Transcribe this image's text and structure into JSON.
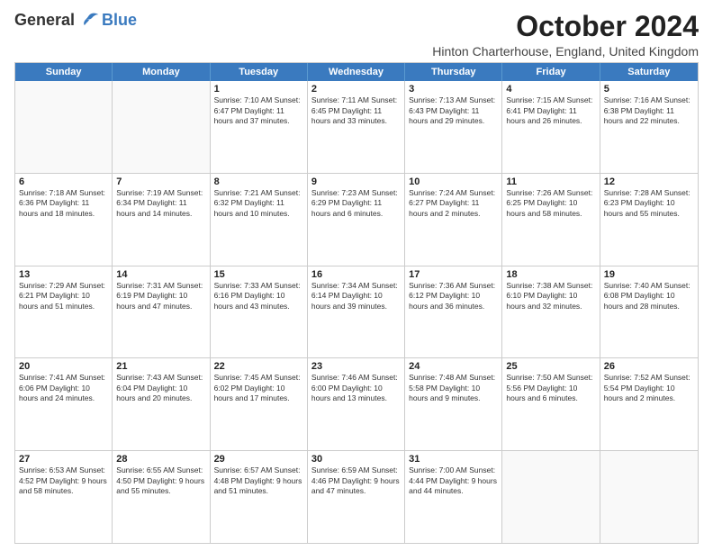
{
  "logo": {
    "general": "General",
    "blue": "Blue"
  },
  "title": "October 2024",
  "location": "Hinton Charterhouse, England, United Kingdom",
  "header_days": [
    "Sunday",
    "Monday",
    "Tuesday",
    "Wednesday",
    "Thursday",
    "Friday",
    "Saturday"
  ],
  "rows": [
    [
      {
        "day": "",
        "text": ""
      },
      {
        "day": "",
        "text": ""
      },
      {
        "day": "1",
        "text": "Sunrise: 7:10 AM\nSunset: 6:47 PM\nDaylight: 11 hours and 37 minutes."
      },
      {
        "day": "2",
        "text": "Sunrise: 7:11 AM\nSunset: 6:45 PM\nDaylight: 11 hours and 33 minutes."
      },
      {
        "day": "3",
        "text": "Sunrise: 7:13 AM\nSunset: 6:43 PM\nDaylight: 11 hours and 29 minutes."
      },
      {
        "day": "4",
        "text": "Sunrise: 7:15 AM\nSunset: 6:41 PM\nDaylight: 11 hours and 26 minutes."
      },
      {
        "day": "5",
        "text": "Sunrise: 7:16 AM\nSunset: 6:38 PM\nDaylight: 11 hours and 22 minutes."
      }
    ],
    [
      {
        "day": "6",
        "text": "Sunrise: 7:18 AM\nSunset: 6:36 PM\nDaylight: 11 hours and 18 minutes."
      },
      {
        "day": "7",
        "text": "Sunrise: 7:19 AM\nSunset: 6:34 PM\nDaylight: 11 hours and 14 minutes."
      },
      {
        "day": "8",
        "text": "Sunrise: 7:21 AM\nSunset: 6:32 PM\nDaylight: 11 hours and 10 minutes."
      },
      {
        "day": "9",
        "text": "Sunrise: 7:23 AM\nSunset: 6:29 PM\nDaylight: 11 hours and 6 minutes."
      },
      {
        "day": "10",
        "text": "Sunrise: 7:24 AM\nSunset: 6:27 PM\nDaylight: 11 hours and 2 minutes."
      },
      {
        "day": "11",
        "text": "Sunrise: 7:26 AM\nSunset: 6:25 PM\nDaylight: 10 hours and 58 minutes."
      },
      {
        "day": "12",
        "text": "Sunrise: 7:28 AM\nSunset: 6:23 PM\nDaylight: 10 hours and 55 minutes."
      }
    ],
    [
      {
        "day": "13",
        "text": "Sunrise: 7:29 AM\nSunset: 6:21 PM\nDaylight: 10 hours and 51 minutes."
      },
      {
        "day": "14",
        "text": "Sunrise: 7:31 AM\nSunset: 6:19 PM\nDaylight: 10 hours and 47 minutes."
      },
      {
        "day": "15",
        "text": "Sunrise: 7:33 AM\nSunset: 6:16 PM\nDaylight: 10 hours and 43 minutes."
      },
      {
        "day": "16",
        "text": "Sunrise: 7:34 AM\nSunset: 6:14 PM\nDaylight: 10 hours and 39 minutes."
      },
      {
        "day": "17",
        "text": "Sunrise: 7:36 AM\nSunset: 6:12 PM\nDaylight: 10 hours and 36 minutes."
      },
      {
        "day": "18",
        "text": "Sunrise: 7:38 AM\nSunset: 6:10 PM\nDaylight: 10 hours and 32 minutes."
      },
      {
        "day": "19",
        "text": "Sunrise: 7:40 AM\nSunset: 6:08 PM\nDaylight: 10 hours and 28 minutes."
      }
    ],
    [
      {
        "day": "20",
        "text": "Sunrise: 7:41 AM\nSunset: 6:06 PM\nDaylight: 10 hours and 24 minutes."
      },
      {
        "day": "21",
        "text": "Sunrise: 7:43 AM\nSunset: 6:04 PM\nDaylight: 10 hours and 20 minutes."
      },
      {
        "day": "22",
        "text": "Sunrise: 7:45 AM\nSunset: 6:02 PM\nDaylight: 10 hours and 17 minutes."
      },
      {
        "day": "23",
        "text": "Sunrise: 7:46 AM\nSunset: 6:00 PM\nDaylight: 10 hours and 13 minutes."
      },
      {
        "day": "24",
        "text": "Sunrise: 7:48 AM\nSunset: 5:58 PM\nDaylight: 10 hours and 9 minutes."
      },
      {
        "day": "25",
        "text": "Sunrise: 7:50 AM\nSunset: 5:56 PM\nDaylight: 10 hours and 6 minutes."
      },
      {
        "day": "26",
        "text": "Sunrise: 7:52 AM\nSunset: 5:54 PM\nDaylight: 10 hours and 2 minutes."
      }
    ],
    [
      {
        "day": "27",
        "text": "Sunrise: 6:53 AM\nSunset: 4:52 PM\nDaylight: 9 hours and 58 minutes."
      },
      {
        "day": "28",
        "text": "Sunrise: 6:55 AM\nSunset: 4:50 PM\nDaylight: 9 hours and 55 minutes."
      },
      {
        "day": "29",
        "text": "Sunrise: 6:57 AM\nSunset: 4:48 PM\nDaylight: 9 hours and 51 minutes."
      },
      {
        "day": "30",
        "text": "Sunrise: 6:59 AM\nSunset: 4:46 PM\nDaylight: 9 hours and 47 minutes."
      },
      {
        "day": "31",
        "text": "Sunrise: 7:00 AM\nSunset: 4:44 PM\nDaylight: 9 hours and 44 minutes."
      },
      {
        "day": "",
        "text": ""
      },
      {
        "day": "",
        "text": ""
      }
    ]
  ]
}
